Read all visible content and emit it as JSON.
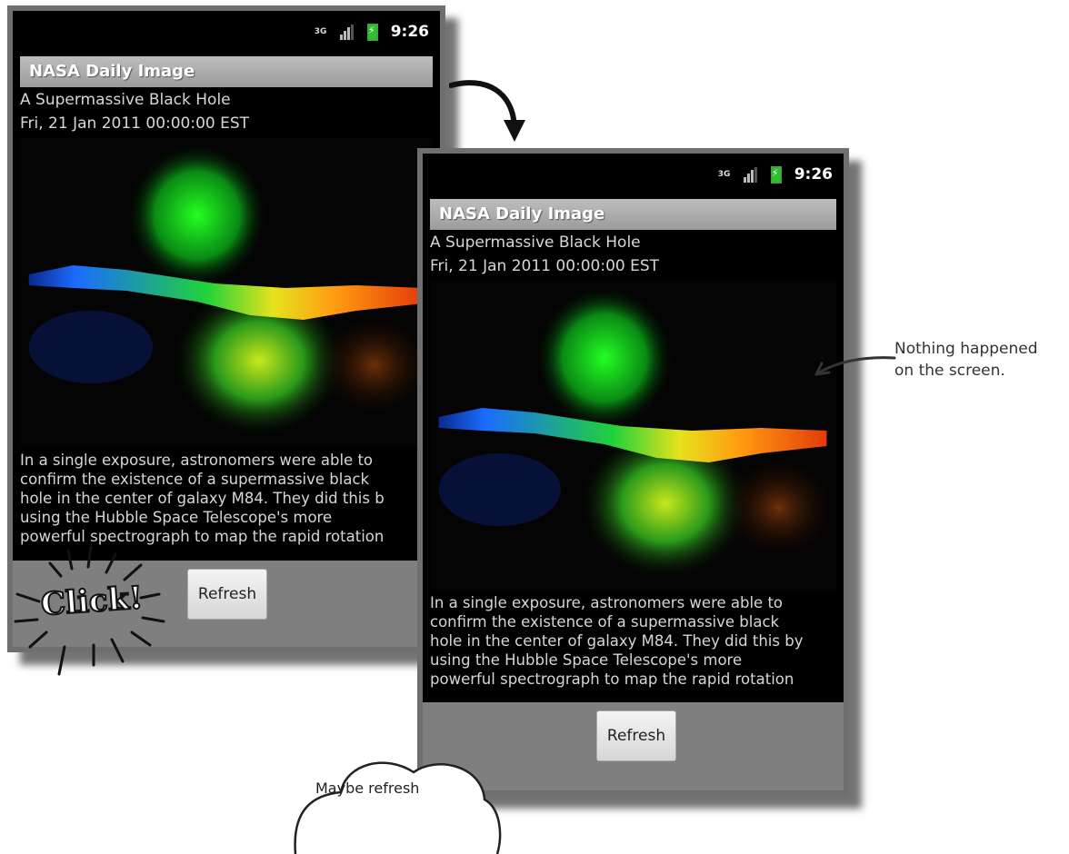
{
  "screen": {
    "status": {
      "network": "3G",
      "time": "9:26"
    },
    "app_title": "NASA Daily Image",
    "image_title": "A Supermassive Black Hole",
    "date": "Fri, 21 Jan 2011 00:00:00 EST",
    "description_lines": [
      "In a single exposure, astronomers were able to",
      "confirm the existence of a supermassive black",
      "hole in the center of galaxy M84. They did this b",
      "using the Hubble Space Telescope's more",
      "powerful spectrograph to map the rapid rotation"
    ],
    "description_lines_after": [
      "In a single exposure, astronomers were able to",
      "confirm the existence of a supermassive black",
      "hole in the center of galaxy M84. They did this by",
      "using the Hubble Space Telescope's more",
      "powerful spectrograph to map the rapid rotation"
    ],
    "refresh_label": "Refresh"
  },
  "annotations": {
    "click_label": "Click!",
    "note_lines": [
      "Nothing happened",
      "on the screen."
    ],
    "cloud_text": "Maybe refresh"
  },
  "colors": {
    "titlebar": "#a9a9a9",
    "bottombar": "#7f7f7f"
  }
}
